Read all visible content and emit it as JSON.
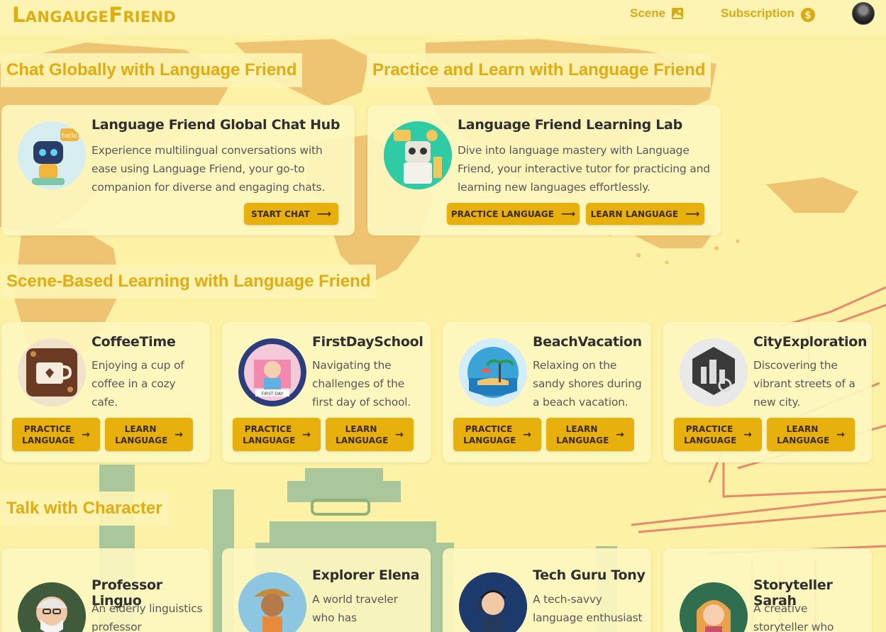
{
  "header": {
    "logo_big1": "L",
    "logo_small1": "ANGAUGE",
    "logo_big2": "F",
    "logo_small2": "RIEND",
    "nav": [
      {
        "label": "Scene",
        "icon": "image-icon"
      },
      {
        "label": "Subscription",
        "icon": "dollar-coin-icon"
      }
    ]
  },
  "sections": {
    "chat_title": "Chat Globally with Language Friend",
    "practice_title": "Practice and Learn with Language Friend",
    "scene_title": "Scene-Based Learning with Language Friend",
    "character_title": "Talk with Character"
  },
  "hub": {
    "title": "Language Friend Global Chat Hub",
    "desc": "Experience multilingual conversations with ease using Language Friend, your go-to companion for diverse and engaging chats.",
    "button": "START CHAT"
  },
  "lab": {
    "title": "Language Friend Learning Lab",
    "desc": "Dive into language mastery with Language Friend, your interactive tutor for practicing and learning new languages effortlessly.",
    "button_practice": "PRACTICE LANGUAGE",
    "button_learn": "LEARN LANGUAGE"
  },
  "scenes": [
    {
      "title": "CoffeeTime",
      "desc": "Enjoying a cup of coffee in a cozy cafe.",
      "practice": "PRACTICE LANGUAGE",
      "learn": "LEARN LANGUAGE"
    },
    {
      "title": "FirstDaySchool",
      "desc": "Navigating the challenges of the first day of school.",
      "practice": "PRACTICE LANGUAGE",
      "learn": "LEARN LANGUAGE"
    },
    {
      "title": "BeachVacation",
      "desc": "Relaxing on the sandy shores during a beach vacation.",
      "practice": "PRACTICE LANGUAGE",
      "learn": "LEARN LANGUAGE"
    },
    {
      "title": "CityExploration",
      "desc": "Discovering the vibrant streets of a new city.",
      "practice": "PRACTICE LANGUAGE",
      "learn": "LEARN LANGUAGE"
    }
  ],
  "characters": [
    {
      "title": "Professor Linguo",
      "desc": "An elderly linguistics professor"
    },
    {
      "title": "Explorer Elena",
      "desc": "A world traveler who has"
    },
    {
      "title": "Tech Guru Tony",
      "desc": "A tech-savvy language enthusiast"
    },
    {
      "title": "Storyteller Sarah",
      "desc": "A creative storyteller who"
    }
  ],
  "colors": {
    "accent": "#e8b00d",
    "title": "#e3ab10",
    "background": "#fdf1a6"
  }
}
